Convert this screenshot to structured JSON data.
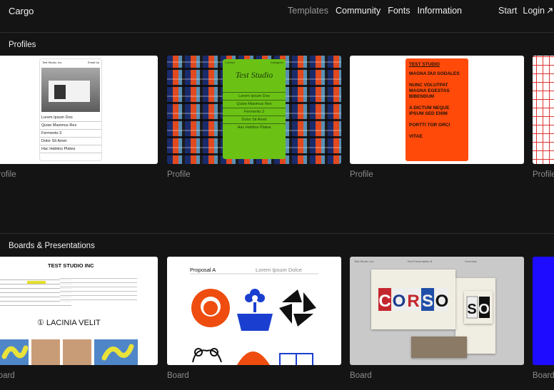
{
  "nav": {
    "brand": "Cargo",
    "links": [
      "Templates",
      "Community",
      "Fonts",
      "Information"
    ],
    "start": "Start",
    "login": "Login"
  },
  "sections": [
    {
      "title": "Profiles",
      "cards": [
        {
          "caption": "Profile",
          "preview": {
            "studio": "Test Studio, Inc.",
            "email": "Email Us",
            "items": [
              "Lorem Ipsum Doo",
              "Quise Maximus Rex",
              "Fermento 3",
              "Dolor Sit Amet",
              "Hac Habitos Platea"
            ]
          }
        },
        {
          "caption": "Profile",
          "preview": {
            "contact": "Contact",
            "instagram": "Instagram",
            "title": "Test Studio",
            "items": [
              "Lorem Ipsum Doo",
              "Quise Maximus Rex",
              "Fermento 3",
              "Dolor Sit Amet",
              "Hac Habitos Platea"
            ]
          }
        },
        {
          "caption": "Profile",
          "preview": {
            "title": "TEST STUDIO",
            "items": [
              "MAGNA DUI SODALES",
              "NUNC VOLUTPAT MAGNA EGESTAS BIBENDUM",
              "A DICTUM NEQUE IPSUM SED ENIM",
              "PORTTI TOR ORCI",
              "VITAE"
            ]
          }
        },
        {
          "caption": "Profile"
        }
      ]
    },
    {
      "title": "Boards & Presentations",
      "cards": [
        {
          "caption": "Board",
          "preview": {
            "heading": "TEST STUDIO INC",
            "feature": "① LACINIA VELIT"
          }
        },
        {
          "caption": "Board",
          "preview": {
            "title": "Proposal A",
            "subtitle": "Lorem Ipsum Dolce"
          }
        },
        {
          "caption": "Board",
          "preview": {
            "bar_left": "Test Studio, Inc.",
            "bar_mid": "Test Presentation B",
            "bar_right": "Overview",
            "word": "CORSO",
            "word2": "SO"
          }
        },
        {
          "caption": "Board"
        }
      ]
    }
  ],
  "colors": {
    "background": "#141414",
    "plaid_red": "#e1491f",
    "lime": "#6bc215",
    "orange": "#ff4a0a",
    "board_blue": "#1d0cff"
  }
}
